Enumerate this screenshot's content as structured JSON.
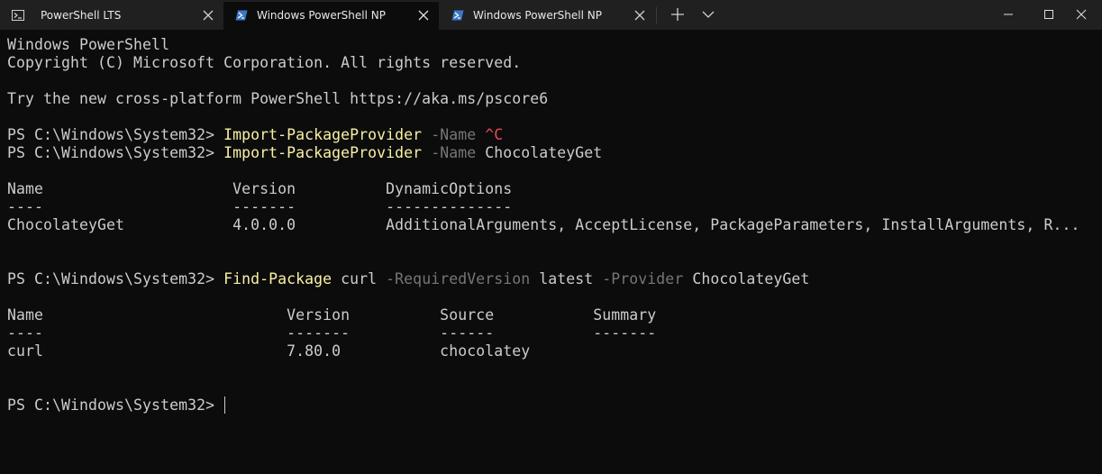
{
  "tabs": [
    {
      "label": "PowerShell LTS",
      "icon": "terminal-icon"
    },
    {
      "label": "Windows PowerShell NP",
      "icon": "powershell-icon",
      "active": true
    },
    {
      "label": "Windows PowerShell NP",
      "icon": "powershell-icon"
    }
  ],
  "terminal": {
    "banner": {
      "title": "Windows PowerShell",
      "copyright": "Copyright (C) Microsoft Corporation. All rights reserved.",
      "tip": "Try the new cross-platform PowerShell https://aka.ms/pscore6"
    },
    "prompt": "PS C:\\Windows\\System32> ",
    "cmd1": {
      "cmdlet": "Import-PackageProvider",
      "param": " -Name ",
      "value": "^C"
    },
    "cmd2": {
      "cmdlet": "Import-PackageProvider",
      "param": " -Name ",
      "value": "ChocolateyGet"
    },
    "provider_table": {
      "header": "Name                     Version          DynamicOptions",
      "underline": "----                     -------          --------------",
      "row": "ChocolateyGet            4.0.0.0          AdditionalArguments, AcceptLicense, PackageParameters, InstallArguments, R..."
    },
    "cmd3": {
      "cmdlet": "Find-Package",
      "arg": " curl",
      "param1": " -RequiredVersion",
      "value1": " latest",
      "param2": " -Provider",
      "value2": " ChocolateyGet"
    },
    "package_table": {
      "header": "Name                           Version          Source           Summary",
      "underline": "----                           -------          ------           -------",
      "row": "curl                           7.80.0           chocolatey"
    }
  },
  "colors": {
    "background": "#0c0c0c",
    "titlebar": "#202020",
    "foreground": "#cccccc",
    "cmdlet": "#f9f1a5",
    "parameter": "#767676",
    "interrupt": "#e74856"
  }
}
